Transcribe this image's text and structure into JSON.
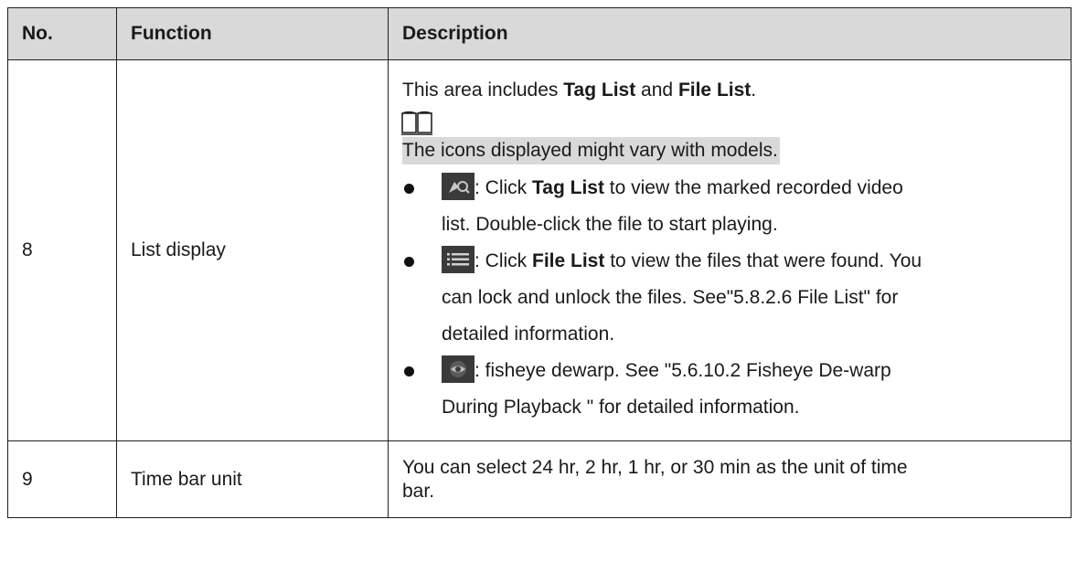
{
  "headers": {
    "no": "No.",
    "function": "Function",
    "description": "Description"
  },
  "rows": [
    {
      "no": "8",
      "function": "List display",
      "intro": {
        "before": "This area includes ",
        "bold1": "Tag List",
        "mid": " and ",
        "bold2": "File List",
        "after": "."
      },
      "note_icon": "book-note-icon",
      "note": "The icons displayed might vary with models.",
      "items": [
        {
          "icon": "tag-search-icon",
          "line1_pre": ": Click ",
          "line1_bold": "Tag List",
          "line1_post": " to view the marked recorded video",
          "line2": "list. Double-click the file to start playing."
        },
        {
          "icon": "file-list-icon",
          "line1_pre": ": Click ",
          "line1_bold": "File List",
          "line1_post": " to view the files that were found. You",
          "line2": "can lock and unlock the files. See\"5.8.2.6 File List\" for",
          "line3": "detailed information."
        },
        {
          "icon": "fisheye-icon",
          "line1": ": fisheye dewarp. See \"5.6.10.2 Fisheye De-warp",
          "line2": "During Playback \" for detailed information."
        }
      ]
    },
    {
      "no": "9",
      "function": "Time bar unit",
      "line1": "You can select 24 hr, 2 hr, 1 hr, or 30 min as the unit of time",
      "line2": "bar."
    }
  ],
  "colors": {
    "header_bg": "#d9d9d9",
    "icon_bg": "#3a3a3a",
    "icon_accent": "#4a90d9"
  }
}
